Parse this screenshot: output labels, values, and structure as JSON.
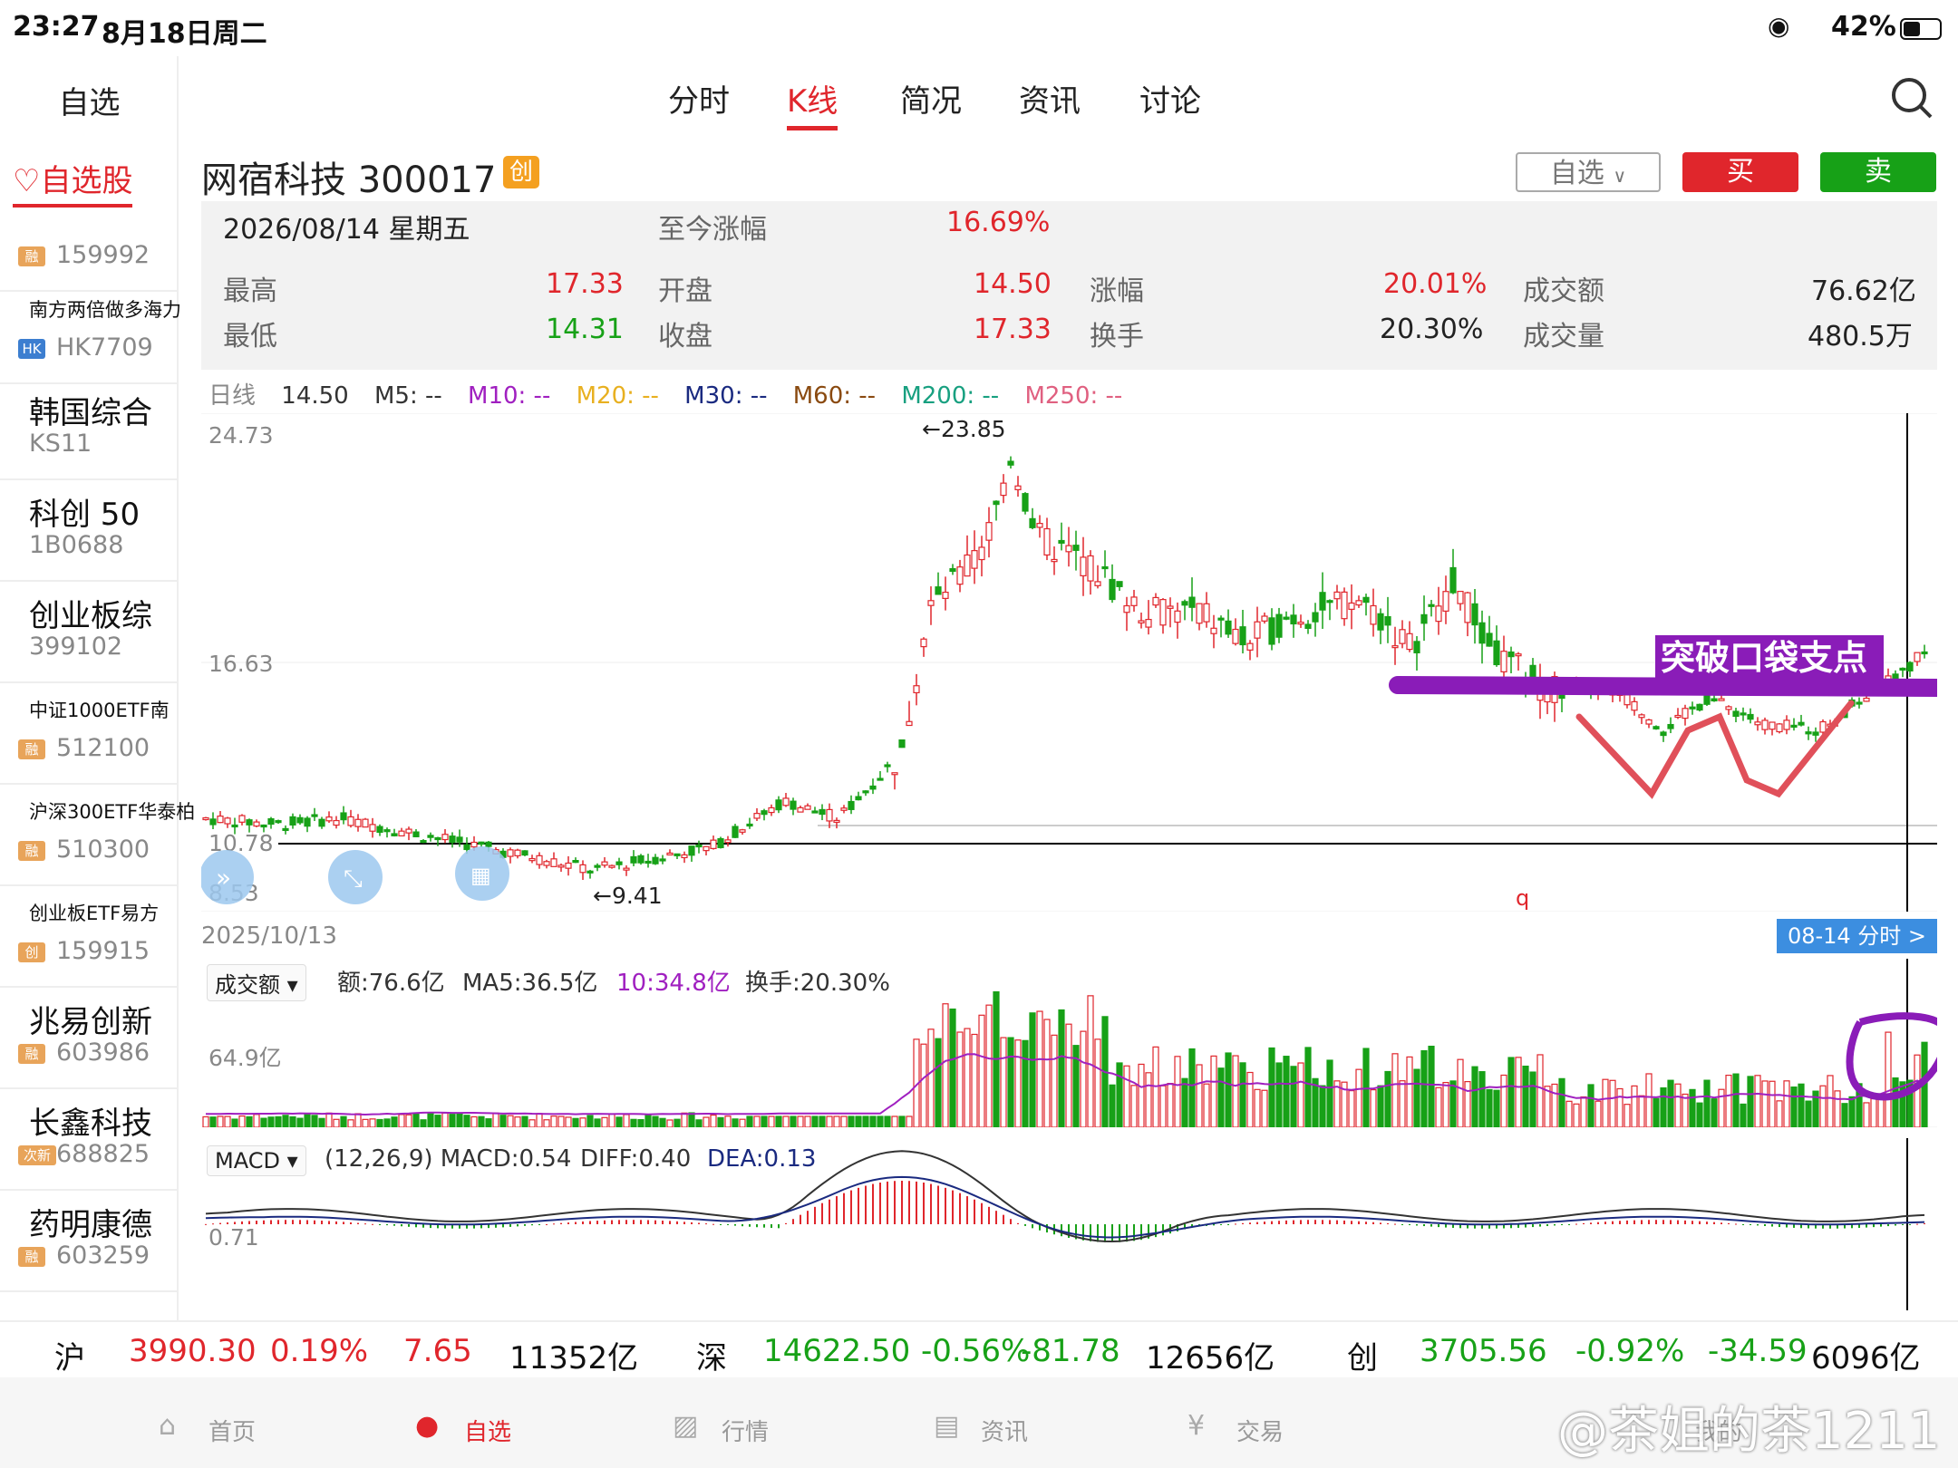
{
  "status": {
    "time": "23:27",
    "date": "8月18日周二",
    "battery": "42%"
  },
  "sidebar": {
    "title": "自选",
    "tab": "自选股",
    "items": [
      {
        "name": "",
        "code": "159992",
        "badge": "融"
      },
      {
        "name": "南方两倍做多海力",
        "code": "HK7709",
        "badge": "HK"
      },
      {
        "name": "韩国综合",
        "code": "KS11",
        "badge": ""
      },
      {
        "name": "科创 50",
        "code": "1B0688",
        "badge": ""
      },
      {
        "name": "创业板综",
        "code": "399102",
        "badge": ""
      },
      {
        "name": "中证1000ETF南",
        "code": "512100",
        "badge": "融"
      },
      {
        "name": "沪深300ETF华泰柏",
        "code": "510300",
        "badge": "融"
      },
      {
        "name": "创业板ETF易方",
        "code": "159915",
        "badge": "创"
      },
      {
        "name": "兆易创新",
        "code": "603986",
        "badge": "融"
      },
      {
        "name": "长鑫科技",
        "code": "688825",
        "badge": "次新"
      },
      {
        "name": "药明康德",
        "code": "603259",
        "badge": "融"
      }
    ]
  },
  "tabs": [
    "分时",
    "K线",
    "简况",
    "资讯",
    "讨论"
  ],
  "active_tab": "K线",
  "stock": {
    "name": "网宿科技 300017",
    "board": "创"
  },
  "buttons": {
    "watch": "自选",
    "buy": "买",
    "sell": "卖"
  },
  "info": {
    "date": "2026/08/14  星期五",
    "ytd_label": "至今涨幅",
    "ytd": "16.69%",
    "high_label": "最高",
    "high": "17.33",
    "low_label": "最低",
    "low": "14.31",
    "open_label": "开盘",
    "open": "14.50",
    "close_label": "收盘",
    "close": "17.33",
    "chg_label": "涨幅",
    "chg": "20.01%",
    "turn_label": "换手",
    "turn": "20.30%",
    "amt_label": "成交额",
    "amt": "76.62亿",
    "vol_label": "成交量",
    "vol": "480.5万"
  },
  "legend": {
    "period": "日线",
    "price": "14.50",
    "m5": "M5: --",
    "m10": "M10: --",
    "m20": "M20: --",
    "m30": "M30: --",
    "m60": "M60: --",
    "m200": "M200: --",
    "m250": "M250: --"
  },
  "kline": {
    "y_top": "24.73",
    "y_mid": "16.63",
    "y_low1": "10.78",
    "y_low2": "8.53",
    "max_label": "←23.85",
    "min_label": "←9.41",
    "annotation": "突破口袋支点",
    "start_date": "2025/10/13",
    "minute_btn": "08-14 分时 >",
    "marker": "q"
  },
  "volume": {
    "selector": "成交额",
    "amt": "额:76.6亿",
    "ma5": "MA5:36.5亿",
    "ma10": "10:34.8亿",
    "turn": "换手:20.30%",
    "axis": "64.9亿"
  },
  "macd": {
    "selector": "MACD",
    "params": "(12,26,9) MACD:0.54",
    "diff": "DIFF:0.40",
    "dea": "DEA:0.13",
    "axis": "0.71"
  },
  "indices": [
    {
      "name": "沪",
      "price": "3990.30",
      "pct": "0.19%",
      "chg": "7.65",
      "amt": "11352亿",
      "color": "#e0262c"
    },
    {
      "name": "深",
      "price": "14622.50",
      "pct": "-0.56%",
      "chg": "-81.78",
      "amt": "12656亿",
      "color": "#17a117"
    },
    {
      "name": "创",
      "price": "3705.56",
      "pct": "-0.92%",
      "chg": "-34.59",
      "amt": "6096亿",
      "color": "#17a117"
    }
  ],
  "nav": [
    "首页",
    "自选",
    "行情",
    "资讯",
    "交易",
    "我的"
  ],
  "watermark": "@茶姐的茶1211",
  "colors": {
    "up": "#e0262c",
    "down": "#17a117",
    "annotation": "#8a1cb8"
  }
}
